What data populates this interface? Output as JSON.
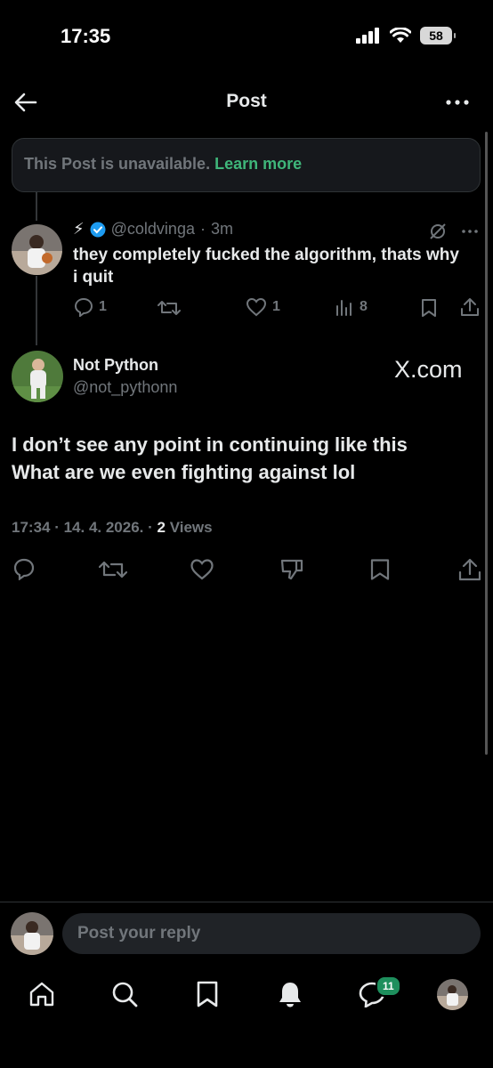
{
  "status_bar": {
    "time": "17:35",
    "battery": "58"
  },
  "header": {
    "title": "Post"
  },
  "unavailable": {
    "text": "This Post is unavailable.",
    "link": "Learn more"
  },
  "reply_post": {
    "emoji": "⚡",
    "handle": "@coldvinga",
    "separator": "·",
    "time": "3m",
    "text": "they completely fucked the algorithm, thats why i quit",
    "replies": "1",
    "likes": "1",
    "views": "8"
  },
  "main_post": {
    "name": "Not Python",
    "handle": "@not_pythonn",
    "watermark": "X.com",
    "line1": "I don’t see any point in continuing like this",
    "line2": "What are we even fighting against lol",
    "meta_prefix": "17:34 · 14. 4. 2026. ·",
    "views_count": "2",
    "views_label": "Views"
  },
  "composer": {
    "placeholder": "Post your reply"
  },
  "tabbar": {
    "messages_badge": "11"
  },
  "colors": {
    "background": "#000000",
    "accent_link": "#3fb67a",
    "badge": "#1e8f5d",
    "verified": "#1d9bf0"
  }
}
